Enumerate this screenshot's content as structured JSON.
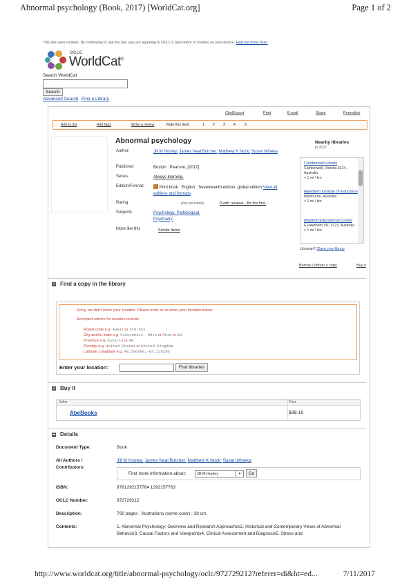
{
  "print_header": {
    "title": "Abnormal psychology (Book, 2017) [WorldCat.org]",
    "page": "Page 1 of 2"
  },
  "print_footer": {
    "url": "http://www.worldcat.org/title/abnormal-psychology/oclc/972729212?referer=di&ht=ed...",
    "date": "7/11/2017"
  },
  "cookie_notice": {
    "text": "This site uses cookies. By continuing to use the site, you are agreeing to OCLC's placement of cookies on your device.",
    "link": "Find out more here."
  },
  "logo": {
    "oclc": "OCLC",
    "name": "WorldCat",
    "reg": "®"
  },
  "search": {
    "label": "Search WorldCat",
    "button": "Search",
    "advanced": "Advanced Search",
    "find_library": "Find a Library"
  },
  "toolbar": {
    "cite": "Cite/Export",
    "print": "Print",
    "email": "E-mail",
    "share": "Share",
    "permalink": "Permalink"
  },
  "actionbar": {
    "add_list": "Add to list",
    "add_tags": "Add tags",
    "write_review": "Write a review",
    "rate_label": "Rate this item:",
    "ratings": [
      "1",
      "2",
      "3",
      "4",
      "5"
    ]
  },
  "record": {
    "title": "Abnormal psychology",
    "author_label": "Author:",
    "authors": [
      "Jill M Hooley;",
      "James Neal Butcher;",
      "Matthew K Nock;",
      "Susan Mineka"
    ],
    "publisher_label": "Publisher:",
    "publisher": "Boston : Pearson, [2017]",
    "series_label": "Series:",
    "series": "Always learning.",
    "edition_label": "Edition/Format:",
    "edition": "Print book : English : Seventeenth edition, global edition",
    "view_editions": "View all editions and formats",
    "rating_label": "Rating:",
    "rating_value": "(not yet rated)",
    "reviews": "0 with reviews - Be the first.",
    "subjects_label": "Subjects",
    "subjects": [
      "Psychology, Pathological.",
      "Psychiatry."
    ],
    "more_label": "More like this",
    "similar": "Similar Items"
  },
  "nearby": {
    "title": "Nearby libraries",
    "subtitle": "to 3122",
    "libraries": [
      {
        "name": "Camberwell Library",
        "address": "Camberwell, Victoria 3124, Australia",
        "distance": "< 1 mi / km"
      },
      {
        "name": "Hawthorn Institute of Education",
        "address": "Melbourne, Australia",
        "distance": "< 1 mi / km"
      },
      {
        "name": "Mayfield Educational Center",
        "address": "E Hawthorn VIC 3123, Australia",
        "distance": "< 1 mi / km"
      }
    ],
    "librarian": "Librarian?",
    "claim": "Claim your library",
    "borrow": "Borrow / obtain a copy",
    "buy": "Buy it"
  },
  "find_copy": {
    "heading": "Find a copy in the library",
    "warning": "Sorry, we don't know your location. Please enter or re-enter your location below.",
    "accepted": "Accepted entries for location include:",
    "entries": [
      {
        "label": "Postal code",
        "eg": "e.g.",
        "examples": [
          "43017",
          "or",
          "SY6-5X2"
        ]
      },
      {
        "label": "City and/or state",
        "eg": "e.g.",
        "examples": [
          "Cincinnati, Ohio",
          "or",
          "Ohio",
          "or",
          "OH"
        ]
      },
      {
        "label": "Province",
        "eg": "e.g.",
        "examples": [
          "Ontario",
          "or",
          "ON"
        ]
      },
      {
        "label": "Country",
        "eg": "e.g.",
        "examples": [
          "United States",
          "or",
          "United Kingdom"
        ]
      },
      {
        "label": "Latitude Longitude",
        "eg": "e.g.",
        "examples": [
          "40.266000,-83.219250"
        ]
      }
    ],
    "enter_label": "Enter your location:",
    "button": "Find libraries"
  },
  "buy_it": {
    "heading": "Buy it",
    "col_seller": "Seller",
    "col_price": "Price",
    "seller": "AbeBooks",
    "price": "$39.10"
  },
  "details": {
    "heading": "Details",
    "doc_type_label": "Document Type:",
    "doc_type": "Book",
    "authors_label": "All Authors / Contributors:",
    "authors": [
      "Jill M Hooley;",
      "James Neal Butcher;",
      "Matthew K Nock;",
      "Susan Mineka"
    ],
    "info_label": "Find more information about:",
    "info_selected": "Jill M Hooley",
    "go": "Go",
    "isbn_label": "ISBN:",
    "isbn": "9781292157764 1292157763",
    "oclc_label": "OCLC Number:",
    "oclc": "972729212",
    "description_label": "Description:",
    "description": "792 pages : illustrations (some color) ; 28 cm.",
    "contents_label": "Contents:",
    "contents": "1. Abnormal Psychology: Overview and Research Approaches2. Historical and Contemporary Views of Abnormal Behavior3. Causal Factors and Viewpoints4. Clinical Assessment and Diagnosis5. Stress and"
  }
}
